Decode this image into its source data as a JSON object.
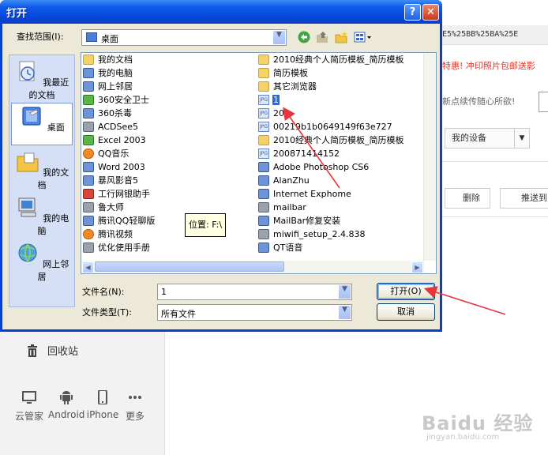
{
  "dialog": {
    "title": "打开",
    "help_label": "?",
    "close_label": "✕",
    "look_in_label": "查找范围(I):",
    "look_in_value": "桌面",
    "file_name_label": "文件名(N):",
    "file_name_value": "1",
    "file_type_label": "文件类型(T):",
    "file_type_value": "所有文件",
    "open_label": "打开(O)",
    "cancel_label": "取消",
    "tooltip": "位置: F:\\"
  },
  "places": [
    {
      "label": "我最近的文档",
      "icon": "recent-docs-icon"
    },
    {
      "label": "桌面",
      "icon": "desktop-icon"
    },
    {
      "label": "我的文档",
      "icon": "my-documents-icon"
    },
    {
      "label": "我的电脑",
      "icon": "my-computer-icon"
    },
    {
      "label": "网上邻居",
      "icon": "network-places-icon"
    }
  ],
  "files_col1": [
    {
      "name": "我的文档",
      "icon": "folder"
    },
    {
      "name": "我的电脑",
      "icon": "app"
    },
    {
      "name": "网上邻居",
      "icon": "app"
    },
    {
      "name": "360安全卫士",
      "icon": "green"
    },
    {
      "name": "360杀毒",
      "icon": "app"
    },
    {
      "name": "ACDSee5",
      "icon": "gray"
    },
    {
      "name": "Excel 2003",
      "icon": "green"
    },
    {
      "name": "QQ音乐",
      "icon": "orange"
    },
    {
      "name": "Word 2003",
      "icon": "app"
    },
    {
      "name": "暴风影音5",
      "icon": "app"
    },
    {
      "name": "工行网银助手",
      "icon": "red"
    },
    {
      "name": "鲁大师",
      "icon": "gray"
    },
    {
      "name": "腾讯QQ轻聊版",
      "icon": "app"
    },
    {
      "name": "腾讯视频",
      "icon": "orange"
    },
    {
      "name": "优化使用手册",
      "icon": "gray"
    }
  ],
  "files_col2": [
    {
      "name": "2010经典个人简历模板_简历模板",
      "icon": "folder"
    },
    {
      "name": "简历模板",
      "icon": "folder"
    },
    {
      "name": "其它浏览器",
      "icon": "folder"
    },
    {
      "name": "1",
      "icon": "jpg",
      "selected": true
    },
    {
      "name": "20",
      "icon": "jpg"
    },
    {
      "name": "00219b1b0649149f63e727",
      "icon": "jpg"
    },
    {
      "name": "2010经典个人简历模板_简历模板",
      "icon": "folder"
    },
    {
      "name": "200871414152",
      "icon": "jpg"
    },
    {
      "name": "Adobe Photoshop CS6",
      "icon": "app"
    },
    {
      "name": "AlanZhu",
      "icon": "app"
    },
    {
      "name": "Internet Exphome",
      "icon": "app"
    },
    {
      "name": "mailbar",
      "icon": "gray"
    },
    {
      "name": "MailBar修复安装",
      "icon": "app"
    },
    {
      "name": "miwifi_setup_2.4.838",
      "icon": "gray"
    },
    {
      "name": "QT语音",
      "icon": "app"
    }
  ],
  "background": {
    "url_fragment": "E5%25BB%25BA%25E",
    "promo": "特惠! 冲印照片包邮送影",
    "hint": "新点续传随心所欲!",
    "device_label": "我的设备",
    "delete_label": "删除",
    "push_label": "推送到",
    "recycle_label": "回收站",
    "platforms": [
      "云管家",
      "Android",
      "iPhone",
      "更多"
    ],
    "watermark": "Baidu 经验",
    "watermark_sub": "jingyan.baidu.com"
  },
  "colors": {
    "titlebar": "#0a3fd6",
    "selection": "#316ac5",
    "annotation_arrow": "#e8343b"
  }
}
